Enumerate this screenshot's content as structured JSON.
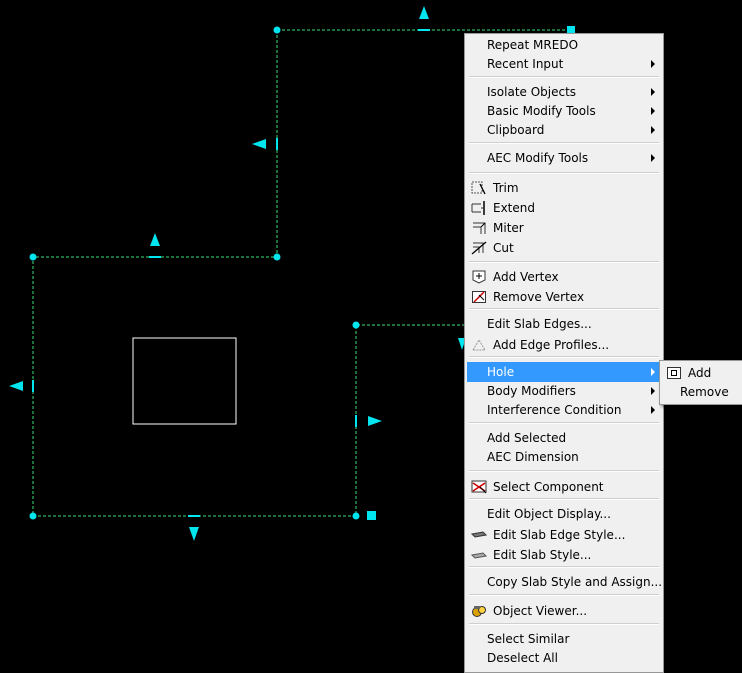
{
  "colors": {
    "background": "#000000",
    "grip": "#00e5ee",
    "edge": "#3fe07a",
    "outline": "#ffffff",
    "menu_bg": "#f0f0f0",
    "highlight": "#3399ff"
  },
  "context_menu": {
    "items": [
      {
        "label": "Repeat MREDO"
      },
      {
        "label": "Recent Input",
        "submenu": true
      },
      {
        "label": "Isolate Objects",
        "submenu": true
      },
      {
        "label": "Basic Modify Tools",
        "submenu": true
      },
      {
        "label": "Clipboard",
        "submenu": true
      },
      {
        "label": "AEC Modify Tools",
        "submenu": true
      },
      {
        "label": "Trim",
        "icon": "trim-icon"
      },
      {
        "label": "Extend",
        "icon": "extend-icon"
      },
      {
        "label": "Miter",
        "icon": "miter-icon"
      },
      {
        "label": "Cut",
        "icon": "cut-icon"
      },
      {
        "label": "Add Vertex",
        "icon": "add-vertex-icon"
      },
      {
        "label": "Remove Vertex",
        "icon": "remove-vertex-icon"
      },
      {
        "label": "Edit Slab Edges..."
      },
      {
        "label": "Add Edge Profiles...",
        "icon": "edge-profile-icon"
      },
      {
        "label": "Hole",
        "submenu": true,
        "highlighted": true
      },
      {
        "label": "Body Modifiers",
        "submenu": true
      },
      {
        "label": "Interference Condition",
        "submenu": true
      },
      {
        "label": "Add Selected"
      },
      {
        "label": "AEC Dimension"
      },
      {
        "label": "Select Component",
        "icon": "select-component-icon"
      },
      {
        "label": "Edit Object Display..."
      },
      {
        "label": "Edit Slab Edge Style...",
        "icon": "slab-edge-style-icon"
      },
      {
        "label": "Edit Slab Style...",
        "icon": "slab-style-icon"
      },
      {
        "label": "Copy Slab Style and Assign..."
      },
      {
        "label": "Object Viewer...",
        "icon": "object-viewer-icon"
      },
      {
        "label": "Select Similar"
      },
      {
        "label": "Deselect All"
      }
    ]
  },
  "hole_submenu": {
    "items": [
      {
        "label": "Add",
        "icon": "add-hole-icon"
      },
      {
        "label": "Remove"
      }
    ]
  }
}
